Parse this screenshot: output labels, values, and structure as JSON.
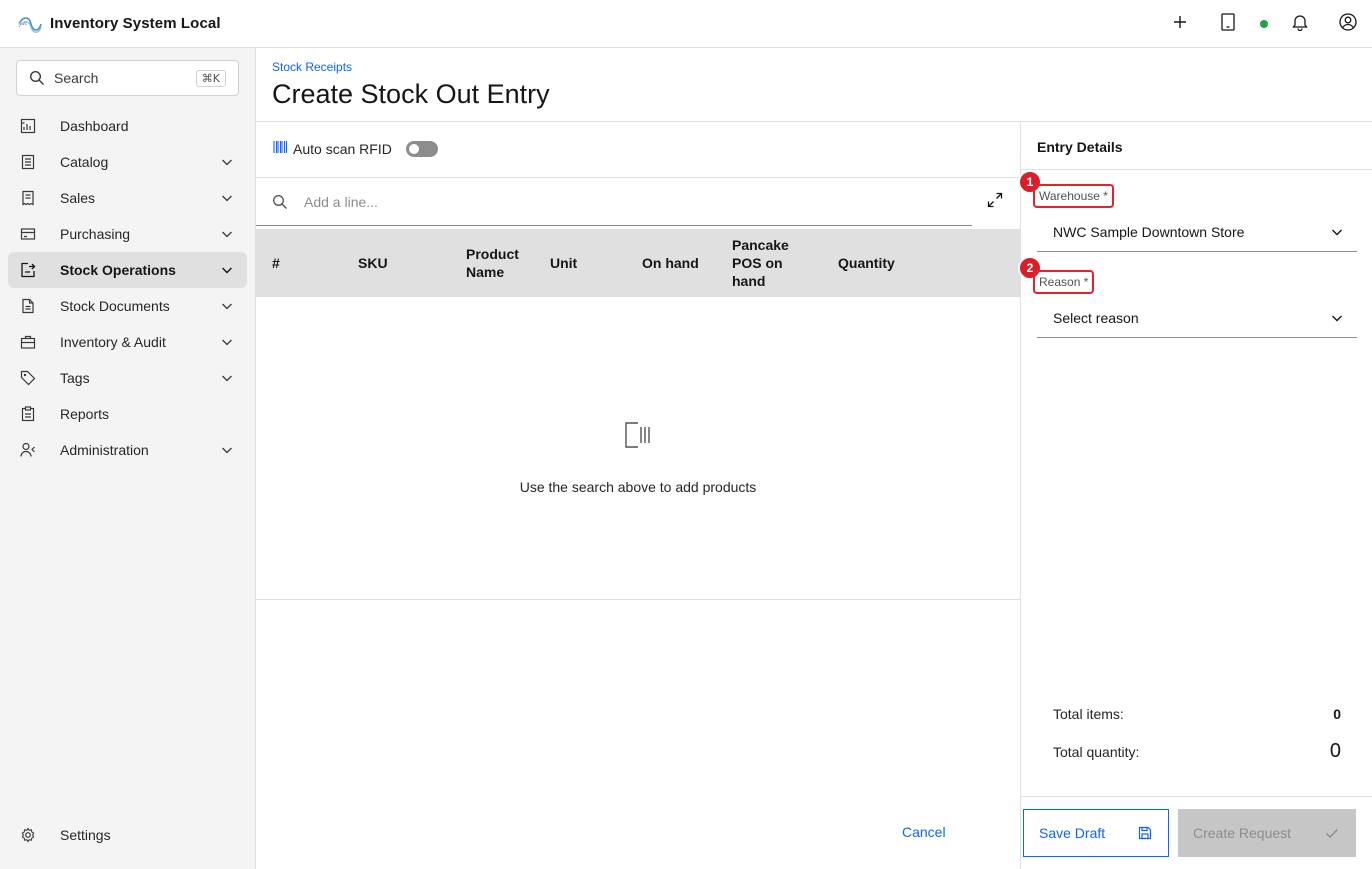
{
  "header": {
    "app_title": "Inventory System Local"
  },
  "sidebar": {
    "search_label": "Search",
    "search_shortcut": "⌘K",
    "items": [
      {
        "label": "Dashboard"
      },
      {
        "label": "Catalog"
      },
      {
        "label": "Sales"
      },
      {
        "label": "Purchasing"
      },
      {
        "label": "Stock Operations"
      },
      {
        "label": "Stock Documents"
      },
      {
        "label": "Inventory & Audit"
      },
      {
        "label": "Tags"
      },
      {
        "label": "Reports"
      },
      {
        "label": "Administration"
      }
    ],
    "settings_label": "Settings"
  },
  "page": {
    "breadcrumb": "Stock Receipts",
    "title": "Create Stock Out Entry"
  },
  "lines": {
    "rfid_label": "Auto scan RFID",
    "add_line_placeholder": "Add a line...",
    "columns": [
      "#",
      "SKU",
      "Product Name",
      "Unit",
      "On hand",
      "Pancake POS on hand",
      "Quantity"
    ],
    "empty_message": "Use the search above to add products",
    "cancel_label": "Cancel"
  },
  "entry_details": {
    "title": "Entry Details",
    "warehouse": {
      "badge": "1",
      "label": "Warehouse *",
      "value": "NWC Sample Downtown Store"
    },
    "reason": {
      "badge": "2",
      "label": "Reason *",
      "value": "Select reason"
    },
    "total_items_label": "Total items:",
    "total_items_value": "0",
    "total_quantity_label": "Total quantity:",
    "total_quantity_value": "0",
    "save_draft_label": "Save Draft",
    "create_request_label": "Create Request"
  },
  "colors": {
    "accent": "#0f62fe",
    "highlight": "#da1e28",
    "status_online": "#24a148"
  },
  "icons": {
    "top": [
      "plus-icon",
      "tablet-icon",
      "notification-icon",
      "user-avatar-icon"
    ]
  }
}
